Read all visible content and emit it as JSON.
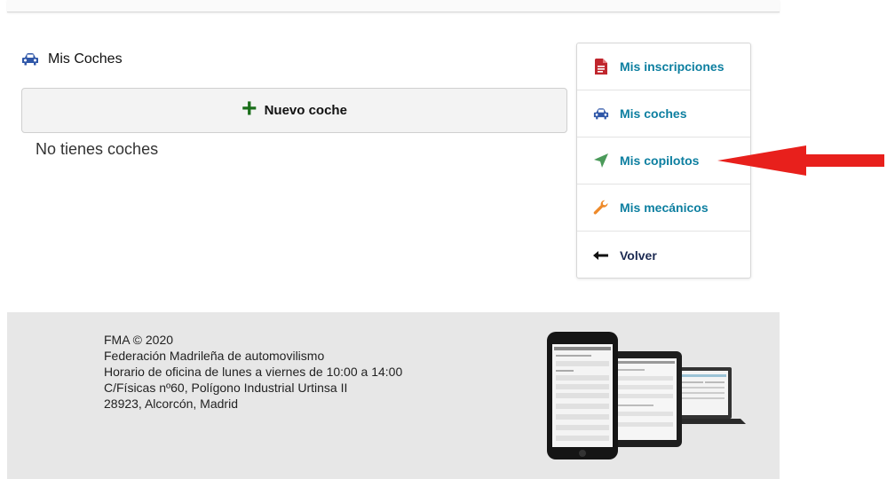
{
  "section": {
    "title": "Mis Coches",
    "icon": "car-icon"
  },
  "new_car": {
    "label": "Nuevo coche",
    "icon": "plus-icon"
  },
  "empty_message": "No tienes coches",
  "menu": {
    "items": [
      {
        "label": "Mis inscripciones",
        "icon": "document-icon",
        "color": "#c0262d"
      },
      {
        "label": "Mis coches",
        "icon": "car-icon",
        "color": "#2f57a8"
      },
      {
        "label": "Mis copilotos",
        "icon": "location-arrow-icon",
        "color": "#4b9a5a"
      },
      {
        "label": "Mis mecánicos",
        "icon": "wrench-icon",
        "color": "#ee8a2a"
      },
      {
        "label": "Volver",
        "icon": "arrow-left-icon",
        "color": "#111111"
      }
    ]
  },
  "annotation": {
    "icon": "red-arrow-icon",
    "color": "#e8201c"
  },
  "footer": {
    "lines": [
      "FMA © 2020",
      "Federación Madrileña de automovilismo",
      "Horario de oficina de lunes a viernes de 10:00 a 14:00",
      "C/Físicas nº60, Polígono Industrial Urtinsa II",
      "28923, Alcorcón, Madrid"
    ],
    "image": "devices-mockup"
  },
  "colors": {
    "link": "#0d7fa0",
    "footer_bg": "#e7e7e7",
    "button_bg": "#f3f3f3"
  }
}
